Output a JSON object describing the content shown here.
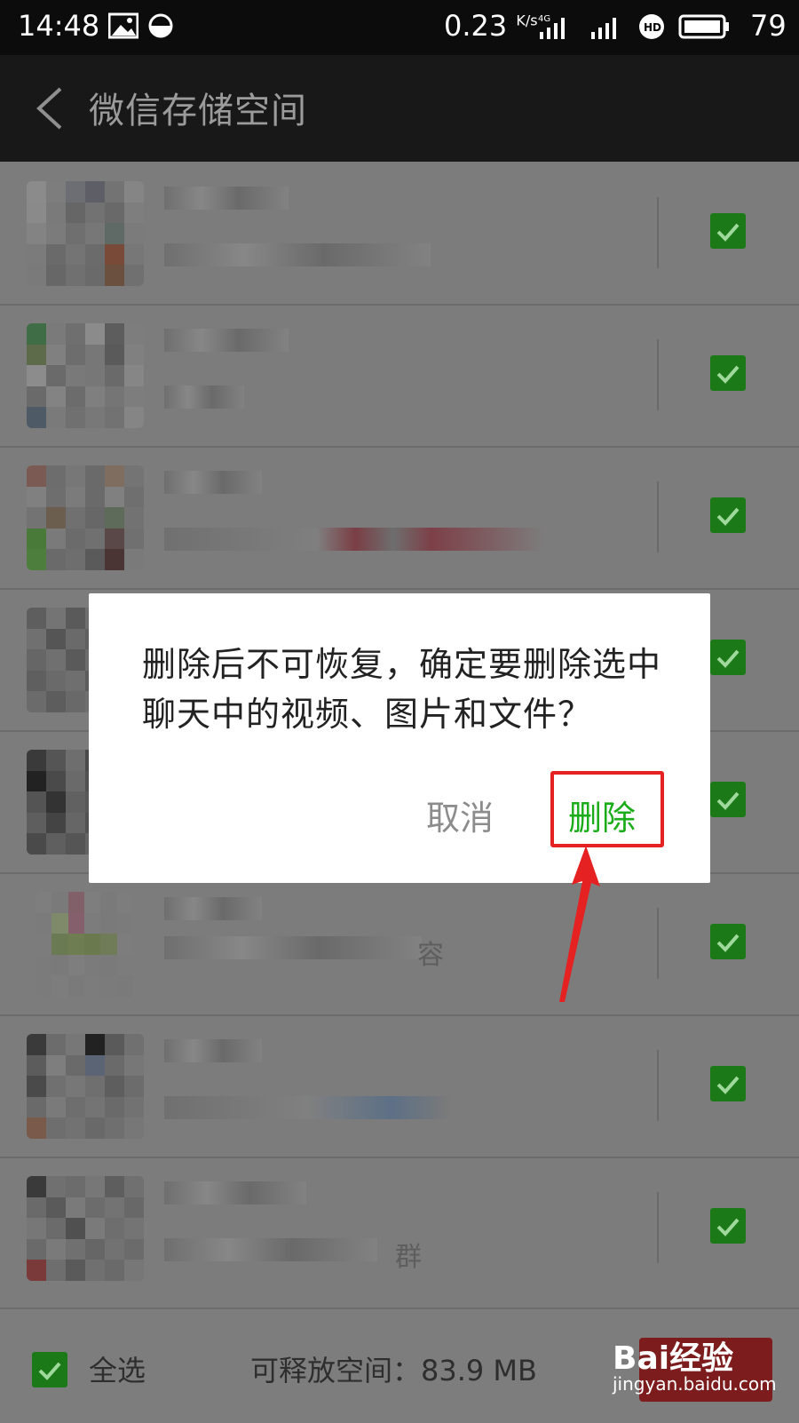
{
  "status_bar": {
    "time": "14:48",
    "speed_value": "0.23",
    "speed_unit": "K/s",
    "battery_level": "79",
    "icons": [
      "image-icon",
      "sync-icon",
      "4g-signal-icon",
      "signal-icon",
      "hd-icon",
      "battery-icon"
    ]
  },
  "header": {
    "back_icon": "chevron-left-icon",
    "title": "微信存储空间"
  },
  "list": {
    "rows": [
      {
        "checked": true,
        "partial_text": ""
      },
      {
        "checked": true,
        "partial_text": ""
      },
      {
        "checked": true,
        "partial_text": ""
      },
      {
        "checked": true,
        "partial_text": ""
      },
      {
        "checked": true,
        "partial_text": ""
      },
      {
        "checked": true,
        "partial_text": "容"
      },
      {
        "checked": true,
        "partial_text": ""
      },
      {
        "checked": true,
        "partial_text": "群"
      }
    ]
  },
  "dialog": {
    "message": "删除后不可恢复，确定要删除选中聊天中的视频、图片和文件？",
    "cancel_label": "取消",
    "confirm_label": "删除"
  },
  "footer": {
    "select_all_label": "全选",
    "free_space_label": "可释放空间：83.9 MB",
    "delete_label": ""
  },
  "watermark": {
    "logo": "Bai经验",
    "url": "jingyan.baidu.com"
  },
  "colors": {
    "accent_green": "#1aad19",
    "checkbox_green": "#1b7a17",
    "annotation_red": "#e52121"
  }
}
